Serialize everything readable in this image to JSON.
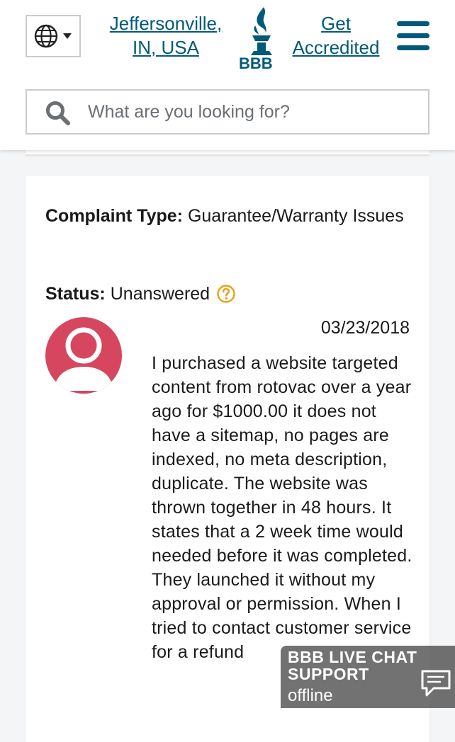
{
  "header": {
    "location_line1": "Jeffersonville,",
    "location_line2": "IN, USA",
    "logo_text": "BBB",
    "accredit_line1": "Get",
    "accredit_line2": "Accredited",
    "icons": {
      "globe": "globe-icon",
      "dropdown": "caret-down-icon",
      "menu": "hamburger-menu-icon",
      "logo": "bbb-torch-logo"
    }
  },
  "search": {
    "placeholder": "What are you looking for?",
    "value": "",
    "icon": "search-icon"
  },
  "complaint": {
    "type_label": "Complaint Type:",
    "type_value": "Guarantee/Warranty Issues",
    "status_label": "Status:",
    "status_value": "Unanswered",
    "status_help_icon": "question-circle-icon",
    "avatar_icon": "user-avatar-icon",
    "date": "03/23/2018",
    "text": "I purchased a website targeted content from rotovac over a year ago for $1000.00 it does not have a sitemap, no pages are indexed, no meta description, duplicate. The website was thrown together in 48 hours. It states that a 2 week time would needed before it was completed. They launched it without my approval or permission. When I tried to contact customer service for a refund"
  },
  "chat_widget": {
    "title_line1": "BBB LIVE CHAT",
    "title_line2": "SUPPORT",
    "status": "offline",
    "icon": "chat-bubble-icon"
  },
  "colors": {
    "brand_blue": "#005a78",
    "avatar_red": "#d6475f",
    "help_orange": "#e8a21b",
    "border_gray": "#c8ccd0"
  }
}
